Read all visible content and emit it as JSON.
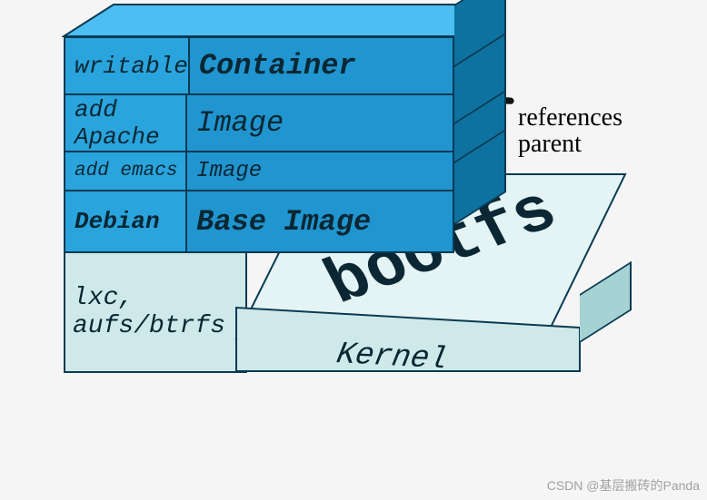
{
  "diagram": {
    "layers": [
      {
        "left": "writable",
        "right": "Container",
        "leftBold": false,
        "rightBold": true
      },
      {
        "left": "add Apache",
        "right": "Image",
        "leftBold": false,
        "rightBold": false
      },
      {
        "left": "add emacs",
        "right": "Image",
        "leftBold": false,
        "rightBold": false
      },
      {
        "left": "Debian",
        "right": "Base Image",
        "leftBold": true,
        "rightBold": true
      }
    ],
    "kernel": {
      "frontLabel": "lxc, aufs/btrfs",
      "topLabel": "bootfs",
      "stepLabel": "Kernel"
    },
    "annotation": {
      "line1": "references",
      "line2": "parent"
    },
    "colors": {
      "layerLeft": "#2aa4dd",
      "layerRight": "#2095cf",
      "layerTop": "#4cbef2",
      "layerSide": "#0e72a0",
      "border": "#0a3a52",
      "kernelFront": "#cfe9ea",
      "kernelTop": "#e4f3f3",
      "kernelSide": "#a6d2d4",
      "text": "#0a2733"
    }
  },
  "watermark": "CSDN @基层搬砖的Panda"
}
